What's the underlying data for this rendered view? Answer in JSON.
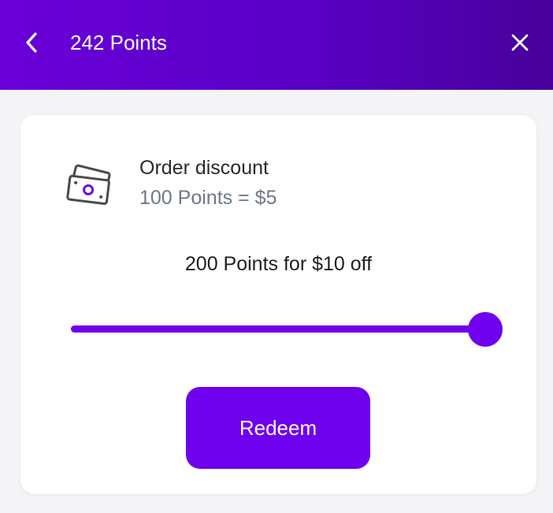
{
  "header": {
    "title": "242 Points",
    "back_icon": "chevron-left-icon",
    "close_icon": "close-icon",
    "gradient_start": "#6a00d8",
    "gradient_end": "#47009a"
  },
  "reward": {
    "icon": "money-bills-icon",
    "title": "Order discount",
    "rate": "100 Points = $5"
  },
  "selection": {
    "text": "200 Points for $10 off",
    "slider_value_fraction": 1.0
  },
  "actions": {
    "redeem_label": "Redeem"
  },
  "colors": {
    "accent": "#6f00ee",
    "rate_text": "#6a7a8a"
  }
}
